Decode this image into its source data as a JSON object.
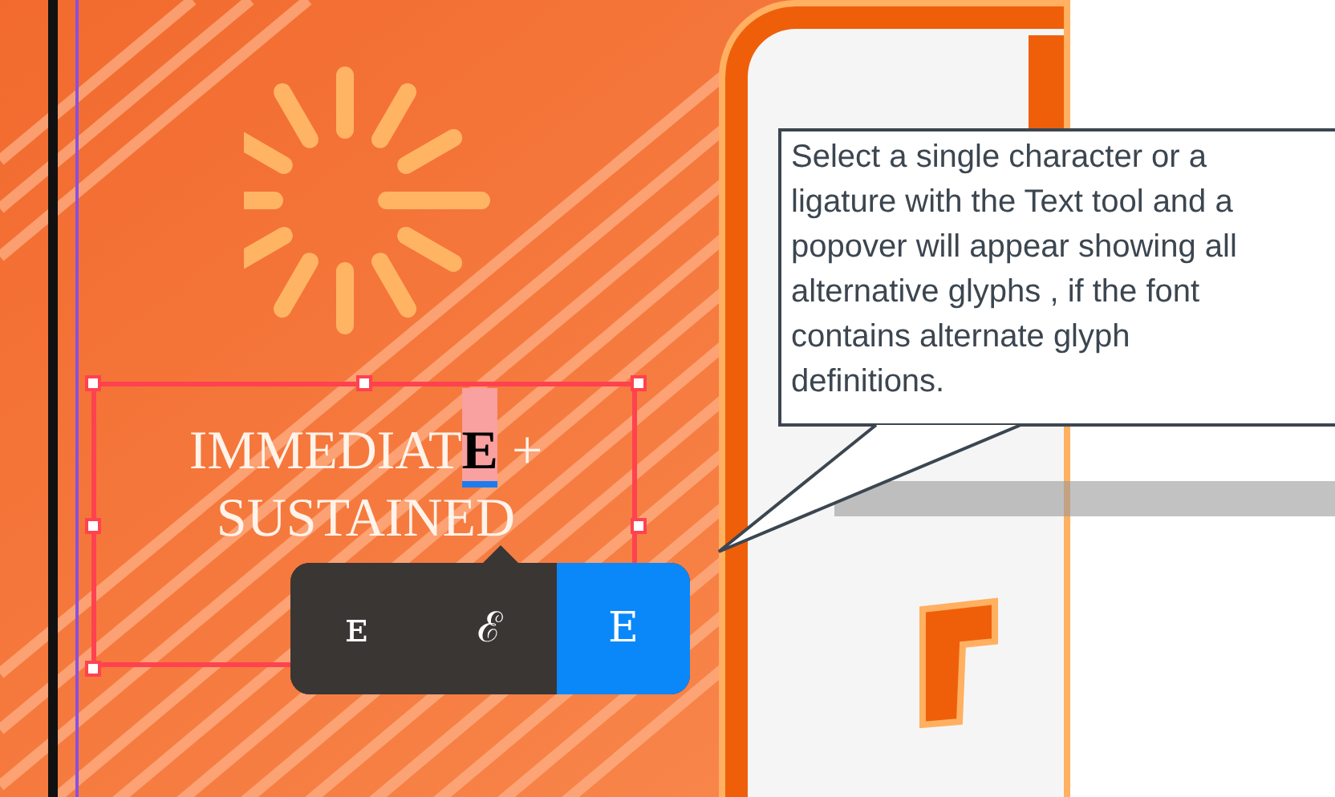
{
  "artwork": {
    "text_lines": [
      {
        "segments": [
          {
            "text": "IMMEDIAT",
            "selected": false
          },
          {
            "text": "E",
            "selected": true
          },
          {
            "text": " +",
            "selected": false
          }
        ]
      },
      {
        "segments": [
          {
            "text": "SUSTAINED",
            "selected": false
          }
        ]
      }
    ]
  },
  "glyph_popover": {
    "options": [
      {
        "glyph": "ᴇ",
        "selected": false
      },
      {
        "glyph": "ℰ",
        "selected": false
      },
      {
        "glyph": "E",
        "selected": true
      }
    ]
  },
  "callout": {
    "text": "Select a single character or a ligature with the Text tool and a popover will appear showing all alternative glyphs , if the font contains alternate glyph definitions."
  }
}
